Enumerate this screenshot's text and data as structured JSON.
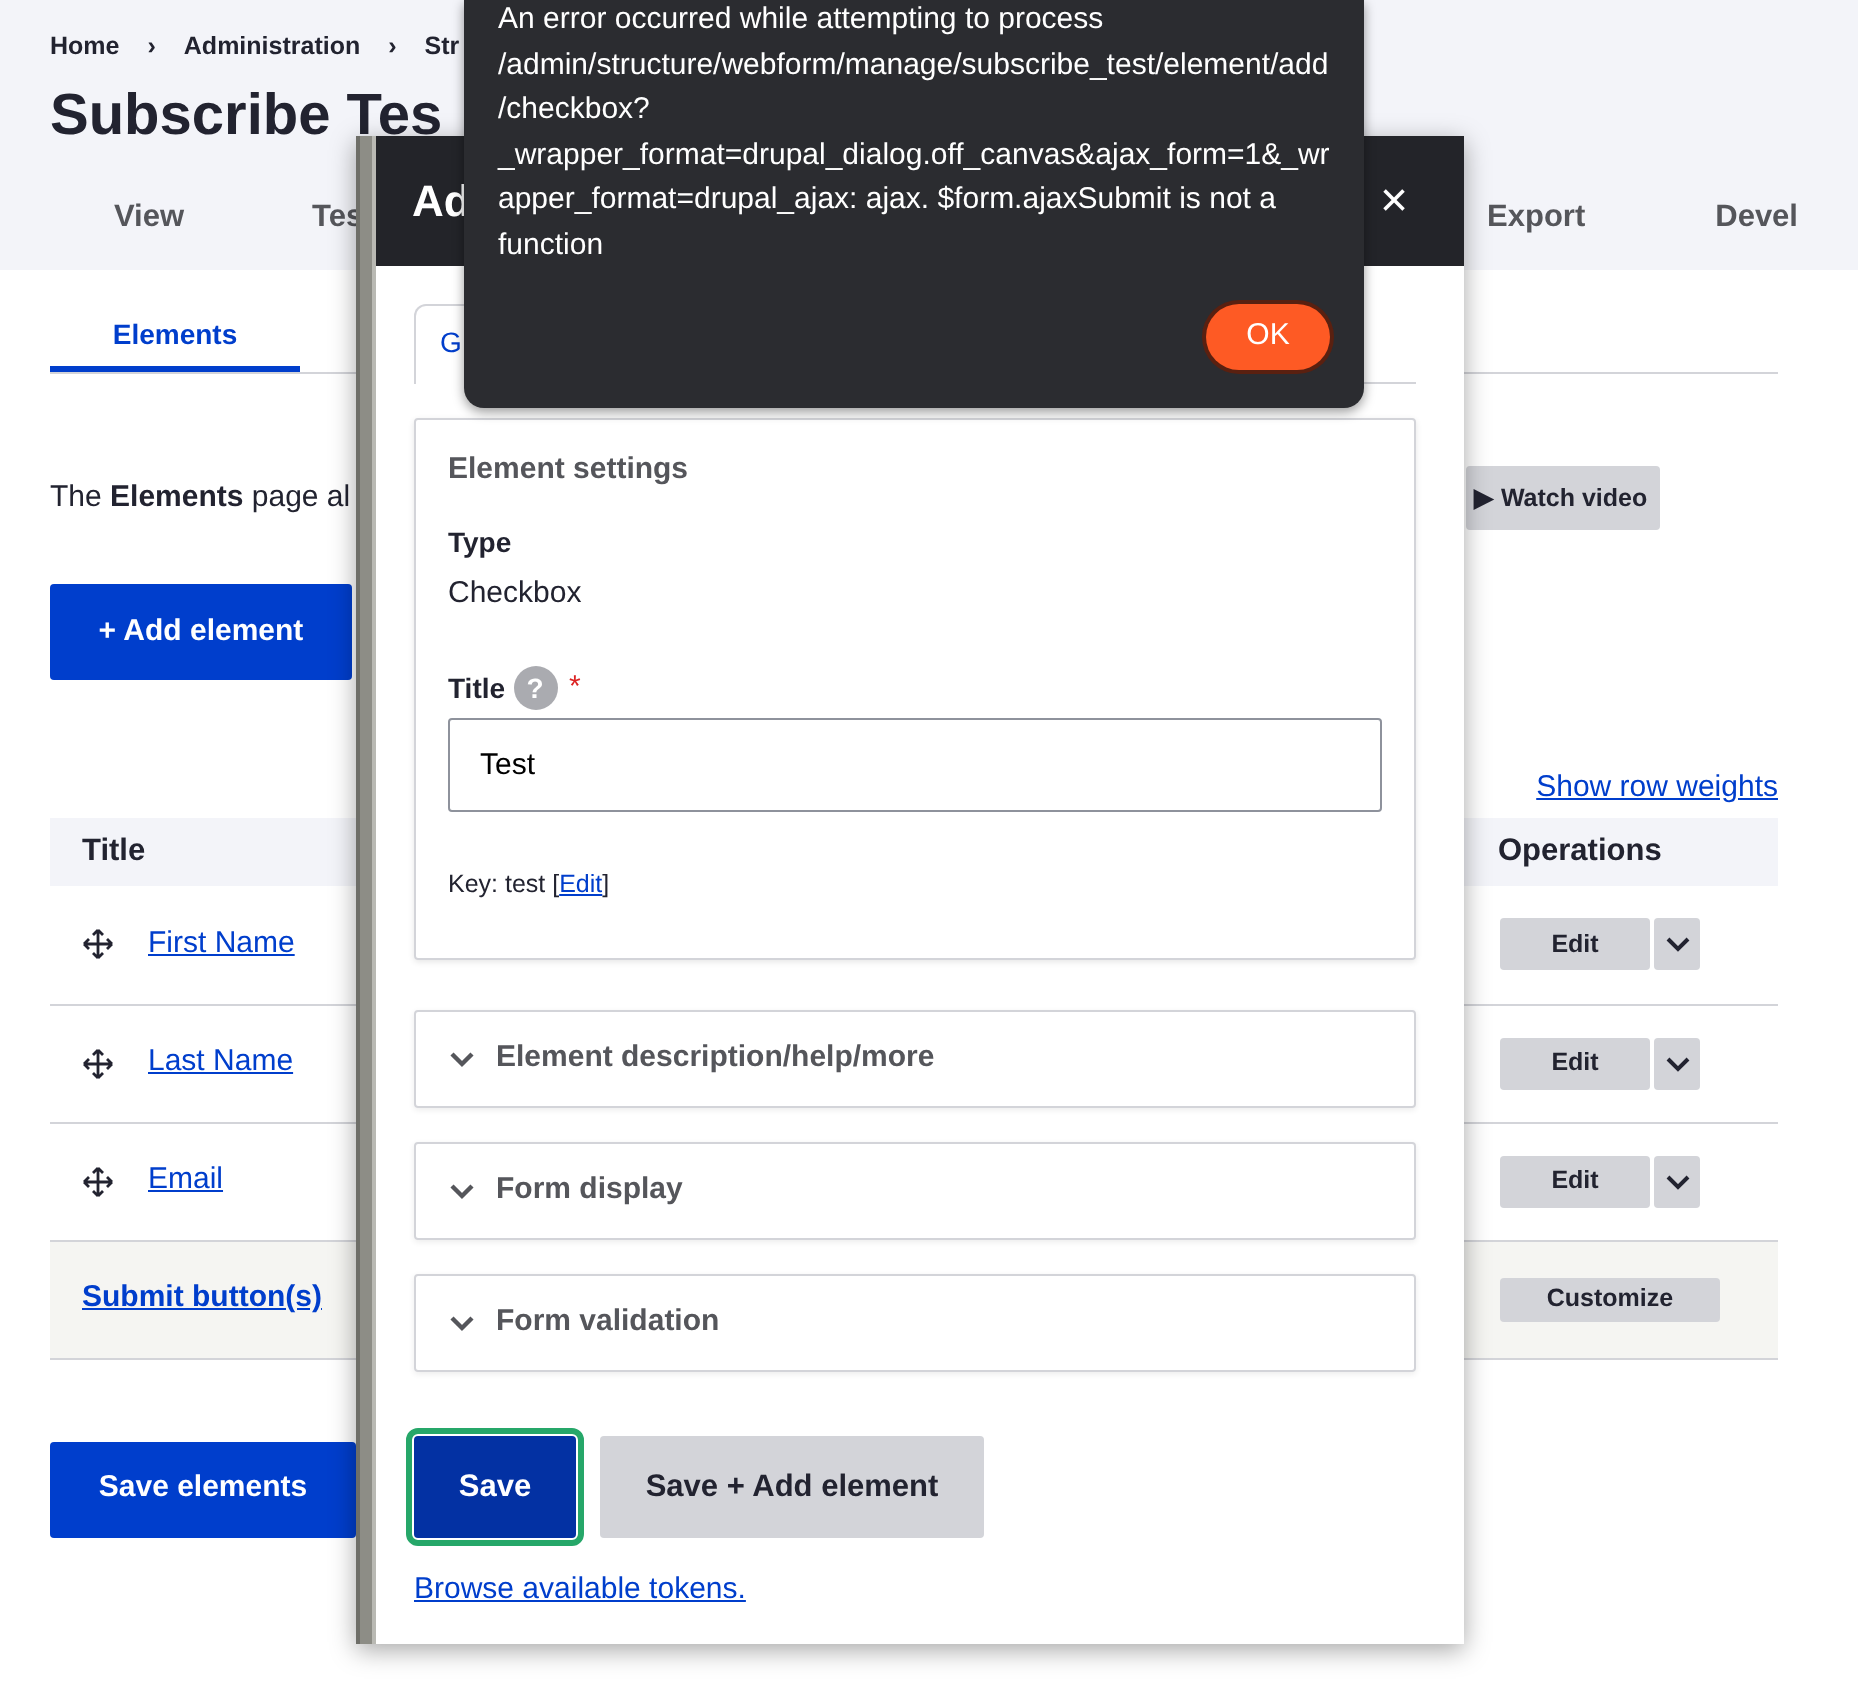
{
  "breadcrumb": [
    "Home",
    "Administration",
    "Str"
  ],
  "separator": "›",
  "page_title": "Subscribe Tes",
  "primary_tabs": [
    {
      "label": "View",
      "selected": false
    },
    {
      "label": "Tes",
      "selected": false
    },
    {
      "label": "Export",
      "selected": false
    },
    {
      "label": "Devel",
      "selected": false
    }
  ],
  "secondary_tabs": [
    {
      "label": "Elements",
      "selected": true
    }
  ],
  "intro": "The **Elements** page al",
  "watch_video": "▶ Watch video",
  "add_button": "+ Add element",
  "show_row_weights": "Show row weights",
  "table": {
    "columns": [
      "Title",
      "Operations"
    ],
    "rows": [
      {
        "kind": "element",
        "title": "First Name",
        "operation": "Edit"
      },
      {
        "kind": "element",
        "title": "Last Name",
        "operation": "Edit"
      },
      {
        "kind": "element",
        "title": "Email",
        "operation": "Edit"
      },
      {
        "kind": "submit",
        "title": "Submit button(s)",
        "operation": "Customize"
      }
    ]
  },
  "save_elements": "Save elements",
  "dialog": {
    "title": "Ad",
    "close": "×",
    "tabs": [
      {
        "label": "G",
        "selected": true
      }
    ],
    "settings": {
      "legend": "Element settings",
      "type_label": "Type",
      "type_value": "Checkbox",
      "title_label": "Title",
      "help": "?",
      "required_mark": "*",
      "title_value": "Test",
      "key_text": "Key: test [",
      "key_link": "Edit",
      "key_end": "]"
    },
    "sections": [
      {
        "label": "Element description/help/more",
        "expanded": false
      },
      {
        "label": "Form display",
        "expanded": false
      },
      {
        "label": "Form validation",
        "expanded": false
      }
    ],
    "buttons": [
      {
        "label": "Save",
        "kind": "primary",
        "focused": true
      },
      {
        "label": "Save + Add element",
        "kind": "secondary",
        "focused": false
      }
    ],
    "tokens_link": "Browse available tokens."
  },
  "alert": {
    "message": "An error occurred while attempting to process /admin/structure/webform/manage/subscribe_test/element/add/checkbox?_wrapper_format=drupal_dialog.off_canvas&ajax_form=1&_wrapper_format=drupal_ajax: ajax. $form.ajaxSubmit is not a function",
    "ok": "OK"
  }
}
